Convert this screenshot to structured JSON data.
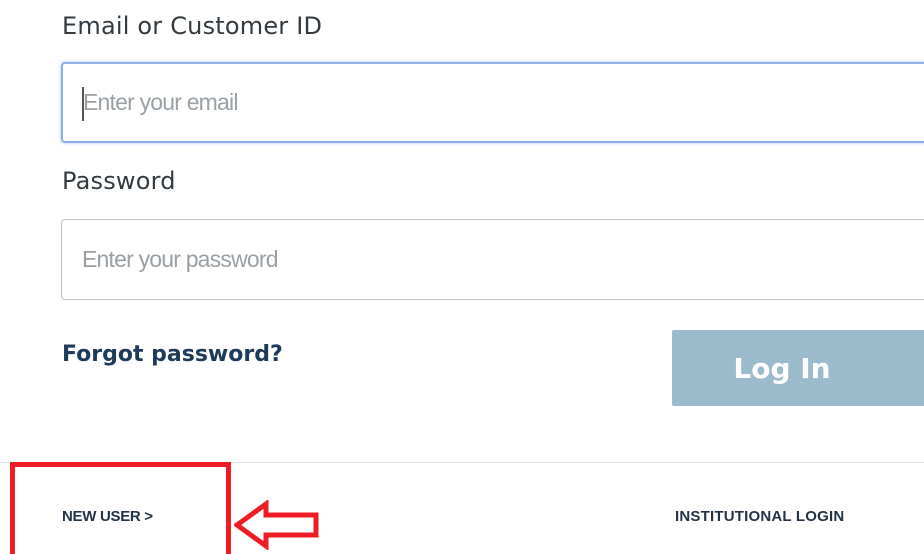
{
  "form": {
    "email_label": "Email or Customer ID",
    "email_placeholder": "Enter your email",
    "email_value": "",
    "password_label": "Password",
    "password_placeholder": "Enter your password",
    "password_value": "",
    "forgot_password": "Forgot password?",
    "login_button": "Log In"
  },
  "footer": {
    "new_user": "NEW USER >",
    "institutional_login": "INSTITUTIONAL LOGIN"
  },
  "annotation": {
    "highlight_color": "#ee1c24",
    "arrow_direction": "left"
  },
  "colors": {
    "login_button_bg": "#9bbacb",
    "focus_border": "#8fb0e6",
    "link_text": "#1f3b5a"
  }
}
